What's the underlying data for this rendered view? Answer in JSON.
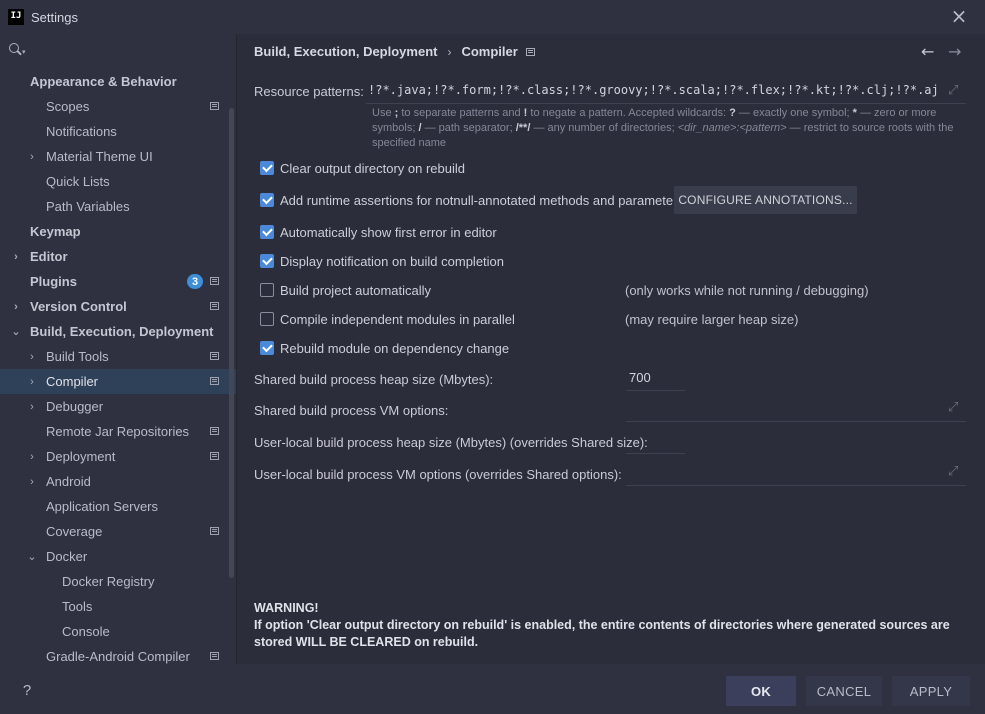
{
  "window": {
    "title": "Settings",
    "logo_text": "IJ"
  },
  "search": {
    "placeholder": "",
    "value": ""
  },
  "sidebar": {
    "items": [
      {
        "label": "Appearance & Behavior",
        "level": 0,
        "bold": true,
        "arrow": ""
      },
      {
        "label": "Scopes",
        "level": 1,
        "bold": false,
        "arrow": "",
        "icon": true
      },
      {
        "label": "Notifications",
        "level": 1,
        "bold": false,
        "arrow": ""
      },
      {
        "label": "Material Theme UI",
        "level": 1,
        "bold": false,
        "arrow": "›"
      },
      {
        "label": "Quick Lists",
        "level": 1,
        "bold": false,
        "arrow": ""
      },
      {
        "label": "Path Variables",
        "level": 1,
        "bold": false,
        "arrow": ""
      },
      {
        "label": "Keymap",
        "level": 0,
        "bold": true,
        "arrow": ""
      },
      {
        "label": "Editor",
        "level": 0,
        "bold": true,
        "arrow": "›"
      },
      {
        "label": "Plugins",
        "level": 0,
        "bold": true,
        "arrow": "",
        "badge": "3",
        "icon": true
      },
      {
        "label": "Version Control",
        "level": 0,
        "bold": true,
        "arrow": "›",
        "icon": true
      },
      {
        "label": "Build, Execution, Deployment",
        "level": 0,
        "bold": true,
        "arrow": "⌄"
      },
      {
        "label": "Build Tools",
        "level": 1,
        "bold": false,
        "arrow": "›",
        "icon": true
      },
      {
        "label": "Compiler",
        "level": 1,
        "bold": false,
        "arrow": "›",
        "icon": true,
        "selected": true
      },
      {
        "label": "Debugger",
        "level": 1,
        "bold": false,
        "arrow": "›"
      },
      {
        "label": "Remote Jar Repositories",
        "level": 1,
        "bold": false,
        "arrow": "",
        "icon": true
      },
      {
        "label": "Deployment",
        "level": 1,
        "bold": false,
        "arrow": "›",
        "icon": true
      },
      {
        "label": "Android",
        "level": 1,
        "bold": false,
        "arrow": "›"
      },
      {
        "label": "Application Servers",
        "level": 1,
        "bold": false,
        "arrow": ""
      },
      {
        "label": "Coverage",
        "level": 1,
        "bold": false,
        "arrow": "",
        "icon": true
      },
      {
        "label": "Docker",
        "level": 1,
        "bold": false,
        "arrow": "⌄"
      },
      {
        "label": "Docker Registry",
        "level": 2,
        "bold": false,
        "arrow": ""
      },
      {
        "label": "Tools",
        "level": 2,
        "bold": false,
        "arrow": ""
      },
      {
        "label": "Console",
        "level": 2,
        "bold": false,
        "arrow": ""
      },
      {
        "label": "Gradle-Android Compiler",
        "level": 1,
        "bold": false,
        "arrow": "",
        "icon": true
      }
    ]
  },
  "breadcrumb": {
    "parent": "Build, Execution, Deployment",
    "separator": "›",
    "current": "Compiler"
  },
  "nav": {
    "back": "←",
    "forward": "→"
  },
  "resource": {
    "label": "Resource patterns:",
    "value": "!?*.java;!?*.form;!?*.class;!?*.groovy;!?*.scala;!?*.flex;!?*.kt;!?*.clj;!?*.aj",
    "hint": {
      "t1": "Use ",
      "semicolon": ";",
      "t2": " to separate patterns and ",
      "bang": "!",
      "t3": " to negate a pattern. Accepted wildcards: ",
      "q": "?",
      "t4": " — exactly one symbol; ",
      "star": "*",
      "t5": " — zero or more symbols; ",
      "slash": "/",
      "t6": " — path separator; ",
      "dstar": "/**/",
      "t7": " — any number of directories; ",
      "dir": "<dir_name>:<pattern>",
      "t8": " — restrict to source roots with the specified name"
    }
  },
  "options": {
    "clear_output": {
      "label": "Clear output directory on rebuild",
      "checked": true
    },
    "runtime_assertions": {
      "label": "Add runtime assertions for notnull-annotated methods and parameters",
      "checked": true
    },
    "configure_button": "CONFIGURE ANNOTATIONS...",
    "show_first_error": {
      "label": "Automatically show first error in editor",
      "checked": true
    },
    "notify_build": {
      "label": "Display notification on build completion",
      "checked": true
    },
    "build_auto": {
      "label": "Build project automatically",
      "checked": false,
      "note": "(only works while not running / debugging)"
    },
    "compile_parallel": {
      "label": "Compile independent modules in parallel",
      "checked": false,
      "note": "(may require larger heap size)"
    },
    "rebuild_dep": {
      "label": "Rebuild module on dependency change",
      "checked": true
    }
  },
  "fields": {
    "heap_size": {
      "label": "Shared build process heap size (Mbytes):",
      "value": "700"
    },
    "vm_options": {
      "label": "Shared build process VM options:",
      "value": ""
    },
    "local_heap": {
      "label": "User-local build process heap size (Mbytes) (overrides Shared size):",
      "value": ""
    },
    "local_vm": {
      "label": "User-local build process VM options (overrides Shared options):",
      "value": ""
    }
  },
  "warning": {
    "title": "WARNING!",
    "text": "If option 'Clear output directory on rebuild' is enabled, the entire contents of directories where generated sources are stored WILL BE CLEARED on rebuild."
  },
  "buttons": {
    "ok": "OK",
    "cancel": "CANCEL",
    "apply": "APPLY",
    "help": "?"
  },
  "colors": {
    "accent": "#4b8ad8",
    "selection": "#2f4158",
    "badge": "#3d8fd8",
    "background": "#2b2d3a"
  }
}
